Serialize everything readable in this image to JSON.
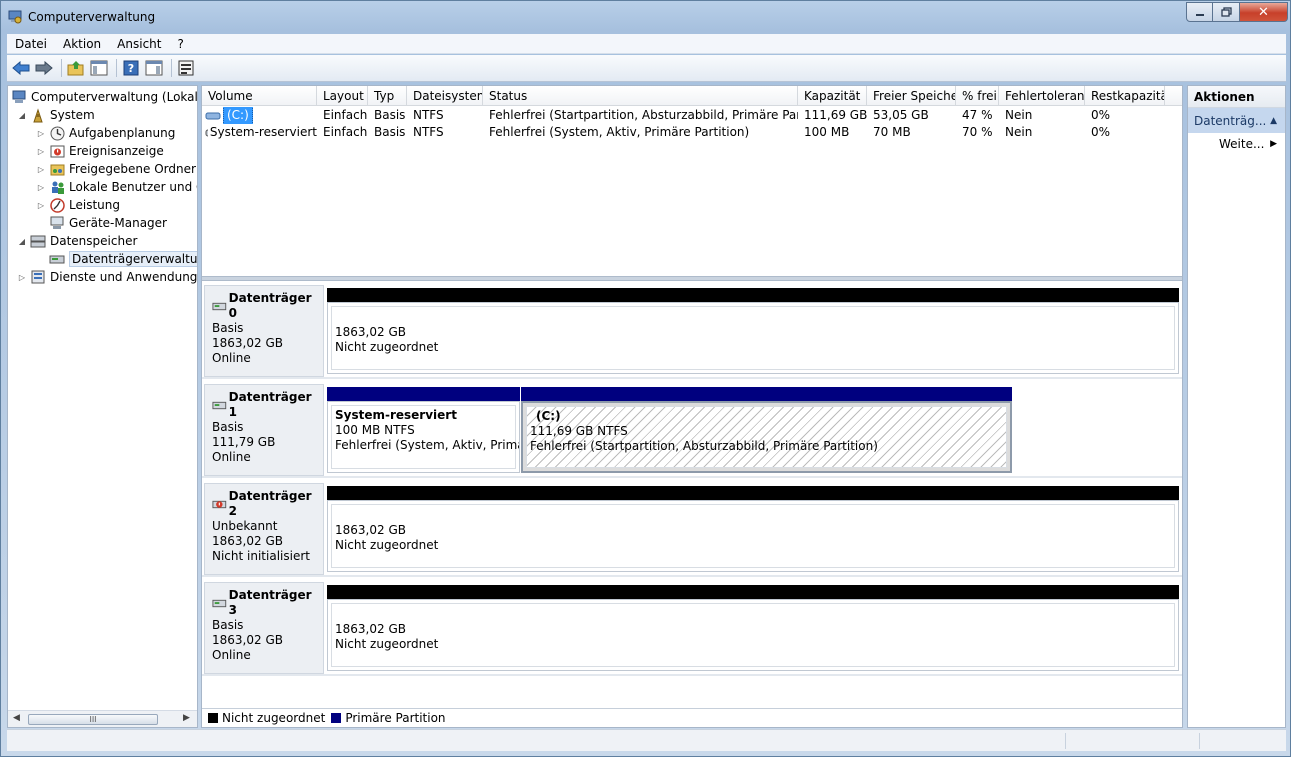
{
  "window": {
    "title": "Computerverwaltung",
    "close_glyph": "✕"
  },
  "menu": [
    "Datei",
    "Aktion",
    "Ansicht",
    "?"
  ],
  "tree": {
    "root": "Computerverwaltung (Lokal)",
    "system": "System",
    "aufgaben": "Aufgabenplanung",
    "ereignis": "Ereignisanzeige",
    "ordner": "Freigegebene Ordner",
    "benutzer": "Lokale Benutzer und Gruppen",
    "leistung": "Leistung",
    "geraete": "Geräte-Manager",
    "datenspeicher": "Datenspeicher",
    "datentraeger": "Datenträgerverwaltung",
    "dienste": "Dienste und Anwendungen",
    "scroll_thumb": "III"
  },
  "volumes": {
    "headers": [
      "Volume",
      "Layout",
      "Typ",
      "Dateisystem",
      "Status",
      "Kapazität",
      "Freier Speicher",
      "% frei",
      "Fehlertoleranz",
      "Restkapazität"
    ],
    "rows": [
      [
        "(C:)",
        "Einfach",
        "Basis",
        "NTFS",
        "Fehlerfrei (Startpartition, Absturzabbild, Primäre Partition)",
        "111,69 GB",
        "53,05 GB",
        "47 %",
        "Nein",
        "0%"
      ],
      [
        "System-reserviert",
        "Einfach",
        "Basis",
        "NTFS",
        "Fehlerfrei (System, Aktiv, Primäre Partition)",
        "100 MB",
        "70 MB",
        "70 %",
        "Nein",
        "0%"
      ]
    ]
  },
  "disks": [
    {
      "name": "Datenträger 0",
      "type": "Basis",
      "size": "1863,02 GB",
      "state": "Online",
      "partitions": [
        {
          "title": "",
          "line1": "1863,02 GB",
          "line2": "Nicht zugeordnet"
        }
      ]
    },
    {
      "name": "Datenträger 1",
      "type": "Basis",
      "size": "111,79 GB",
      "state": "Online",
      "partitions": [
        {
          "title": "System-reserviert",
          "line1": "100 MB NTFS",
          "line2": "Fehlerfrei (System, Aktiv, Primäre Partition)"
        },
        {
          "title": "(C:)",
          "line1": "111,69 GB NTFS",
          "line2": "Fehlerfrei (Startpartition, Absturzabbild, Primäre Partition)"
        }
      ]
    },
    {
      "name": "Datenträger 2",
      "type": "Unbekannt",
      "size": "1863,02 GB",
      "state": "Nicht initialisiert",
      "partitions": [
        {
          "title": "",
          "line1": "1863,02 GB",
          "line2": "Nicht zugeordnet"
        }
      ]
    },
    {
      "name": "Datenträger 3",
      "type": "Basis",
      "size": "1863,02 GB",
      "state": "Online",
      "partitions": [
        {
          "title": "",
          "line1": "1863,02 GB",
          "line2": "Nicht zugeordnet"
        }
      ]
    }
  ],
  "legend": {
    "unallocated": "Nicht zugeordnet",
    "primary": "Primäre Partition"
  },
  "actions": {
    "header": "Aktionen",
    "section": "Datenträg...",
    "more": "Weite..."
  },
  "colors": {
    "unallocated": "#000000",
    "primary": "#00007f",
    "selection": "#3399ff"
  }
}
